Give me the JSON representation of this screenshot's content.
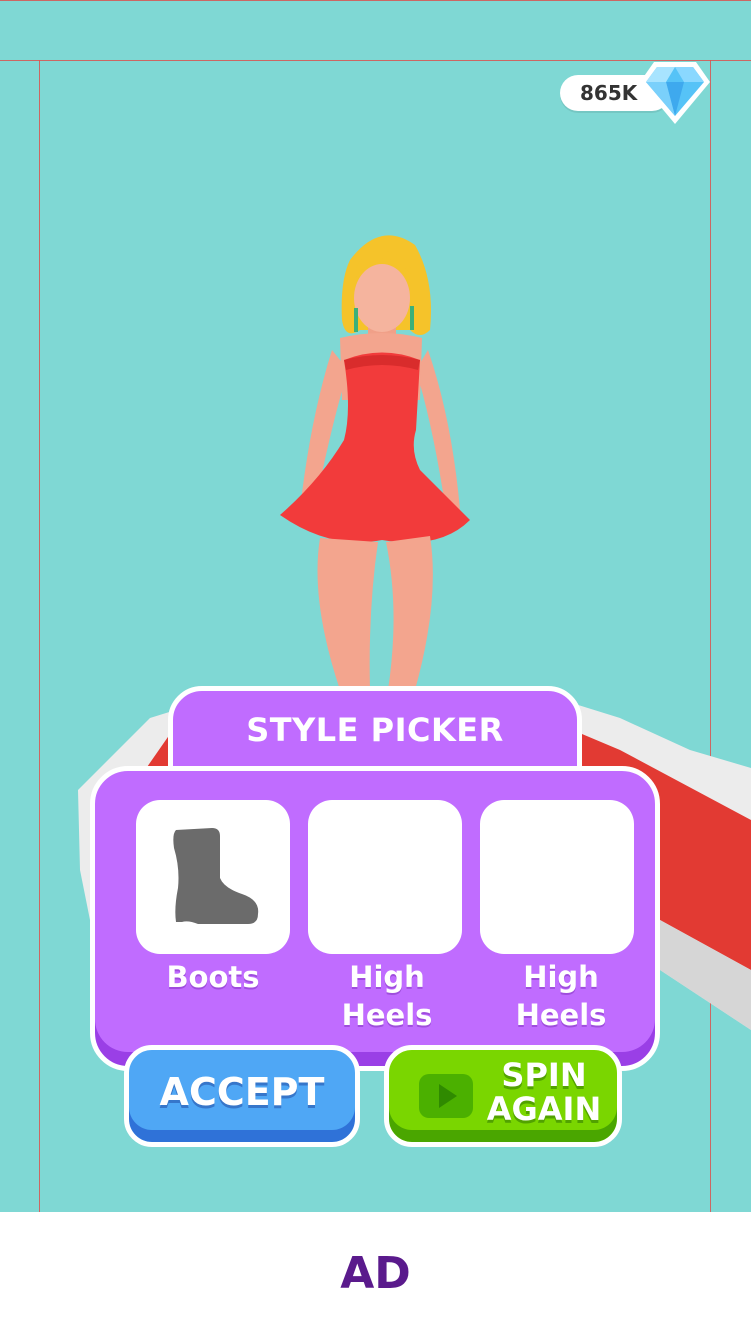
{
  "currency": {
    "amount": "865K",
    "icon": "diamond-icon"
  },
  "picker": {
    "title": "STYLE PICKER",
    "options": [
      {
        "label": "Boots",
        "icon": "boot-icon"
      },
      {
        "label": "High\nHeels",
        "icon": ""
      },
      {
        "label": "High\nHeels",
        "icon": ""
      }
    ]
  },
  "buttons": {
    "accept": "ACCEPT",
    "spin": "SPIN\nAGAIN",
    "spin_icon": "video-play-icon"
  },
  "ad": {
    "label": "AD"
  },
  "colors": {
    "background": "#7fd8d4",
    "picker_purple": "#c06cff",
    "accept_blue": "#4fa7f5",
    "spin_green": "#7ad600",
    "ad_text": "#5a1a8c",
    "dress_red": "#f23b3b"
  }
}
